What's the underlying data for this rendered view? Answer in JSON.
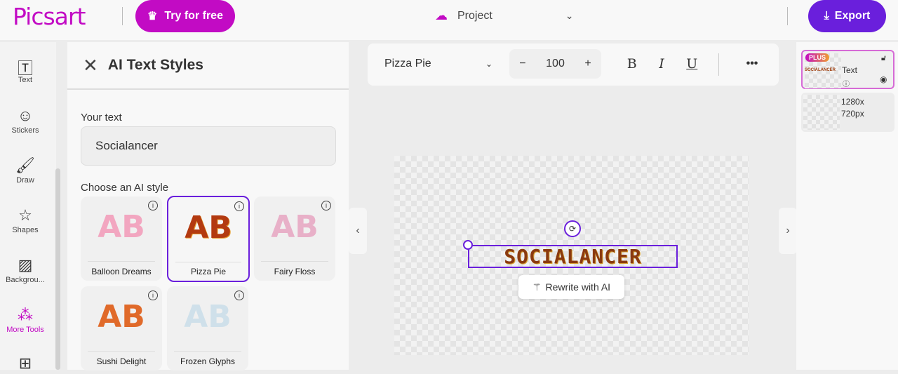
{
  "header": {
    "logo": "Picsart",
    "try_label": "Try for free",
    "project_label": "Project",
    "export_label": "Export"
  },
  "rail": {
    "items": [
      {
        "label": "Text",
        "icon": "text-icon"
      },
      {
        "label": "Stickers",
        "icon": "sticker-icon"
      },
      {
        "label": "Draw",
        "icon": "brush-icon"
      },
      {
        "label": "Shapes",
        "icon": "star-icon"
      },
      {
        "label": "Backgrou...",
        "icon": "background-icon"
      },
      {
        "label": "More Tools",
        "icon": "more-tools-icon"
      }
    ],
    "active_color": "#c20bc4"
  },
  "panel": {
    "title": "AI Text Styles",
    "your_text_label": "Your text",
    "text_value": "Socialancer",
    "choose_label": "Choose an AI style",
    "styles": [
      {
        "name": "Balloon Dreams",
        "preview": "AB",
        "selected": false
      },
      {
        "name": "Pizza Pie",
        "preview": "AB",
        "selected": true
      },
      {
        "name": "Fairy Floss",
        "preview": "AB",
        "selected": false
      },
      {
        "name": "Sushi Delight",
        "preview": "AB",
        "selected": false
      },
      {
        "name": "Frozen Glyphs",
        "preview": "AB",
        "selected": false
      }
    ]
  },
  "toolbar": {
    "font": "Pizza Pie",
    "size": "100",
    "bold": "B",
    "italic": "I",
    "underline": "U",
    "more": "•••"
  },
  "canvas": {
    "text": "SOCIALANCER",
    "rewrite_label": "Rewrite with AI"
  },
  "layers": [
    {
      "badge": "PLUS",
      "thumb_text": "SOCIALANCER",
      "label": "Text"
    },
    {
      "label1": "1280x",
      "label2": "720px"
    }
  ],
  "colors": {
    "brand": "#c20bc4",
    "accent": "#6a1fdc"
  }
}
